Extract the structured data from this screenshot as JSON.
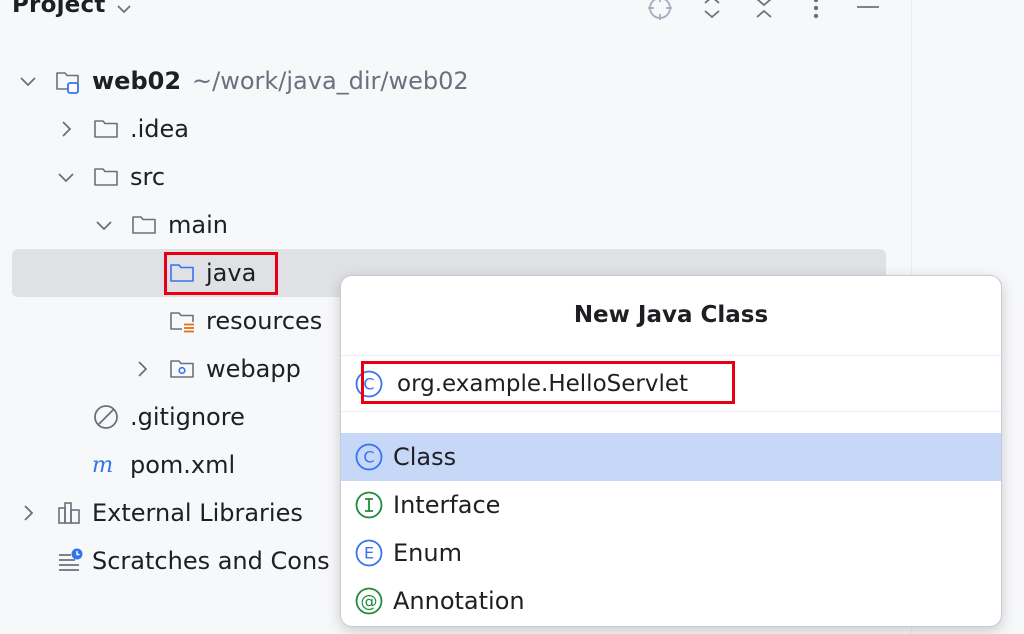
{
  "panel": {
    "title": "Project"
  },
  "tree": {
    "root_name": "web02",
    "root_path": "~/work/java_dir/web02",
    "idea": ".idea",
    "src": "src",
    "main": "main",
    "java": "java",
    "resources": "resources",
    "webapp": "webapp",
    "gitignore": ".gitignore",
    "pom": "pom.xml",
    "external_libraries": "External Libraries",
    "scratches": "Scratches and Cons"
  },
  "popup": {
    "title": "New Java Class",
    "input_value": "org.example.HelloServlet",
    "kinds": [
      {
        "label": "Class",
        "letter": "C",
        "color": "#3574f0"
      },
      {
        "label": "Interface",
        "letter": "I",
        "color": "#208a3c"
      },
      {
        "label": "Enum",
        "letter": "E",
        "color": "#3574f0"
      },
      {
        "label": "Annotation",
        "letter": "@",
        "color": "#208a3c"
      }
    ]
  },
  "colors": {
    "selection": "#dfe1e5",
    "popup_selection": "#c6d7f7",
    "highlight": "#e60012",
    "accent": "#3574f0"
  }
}
